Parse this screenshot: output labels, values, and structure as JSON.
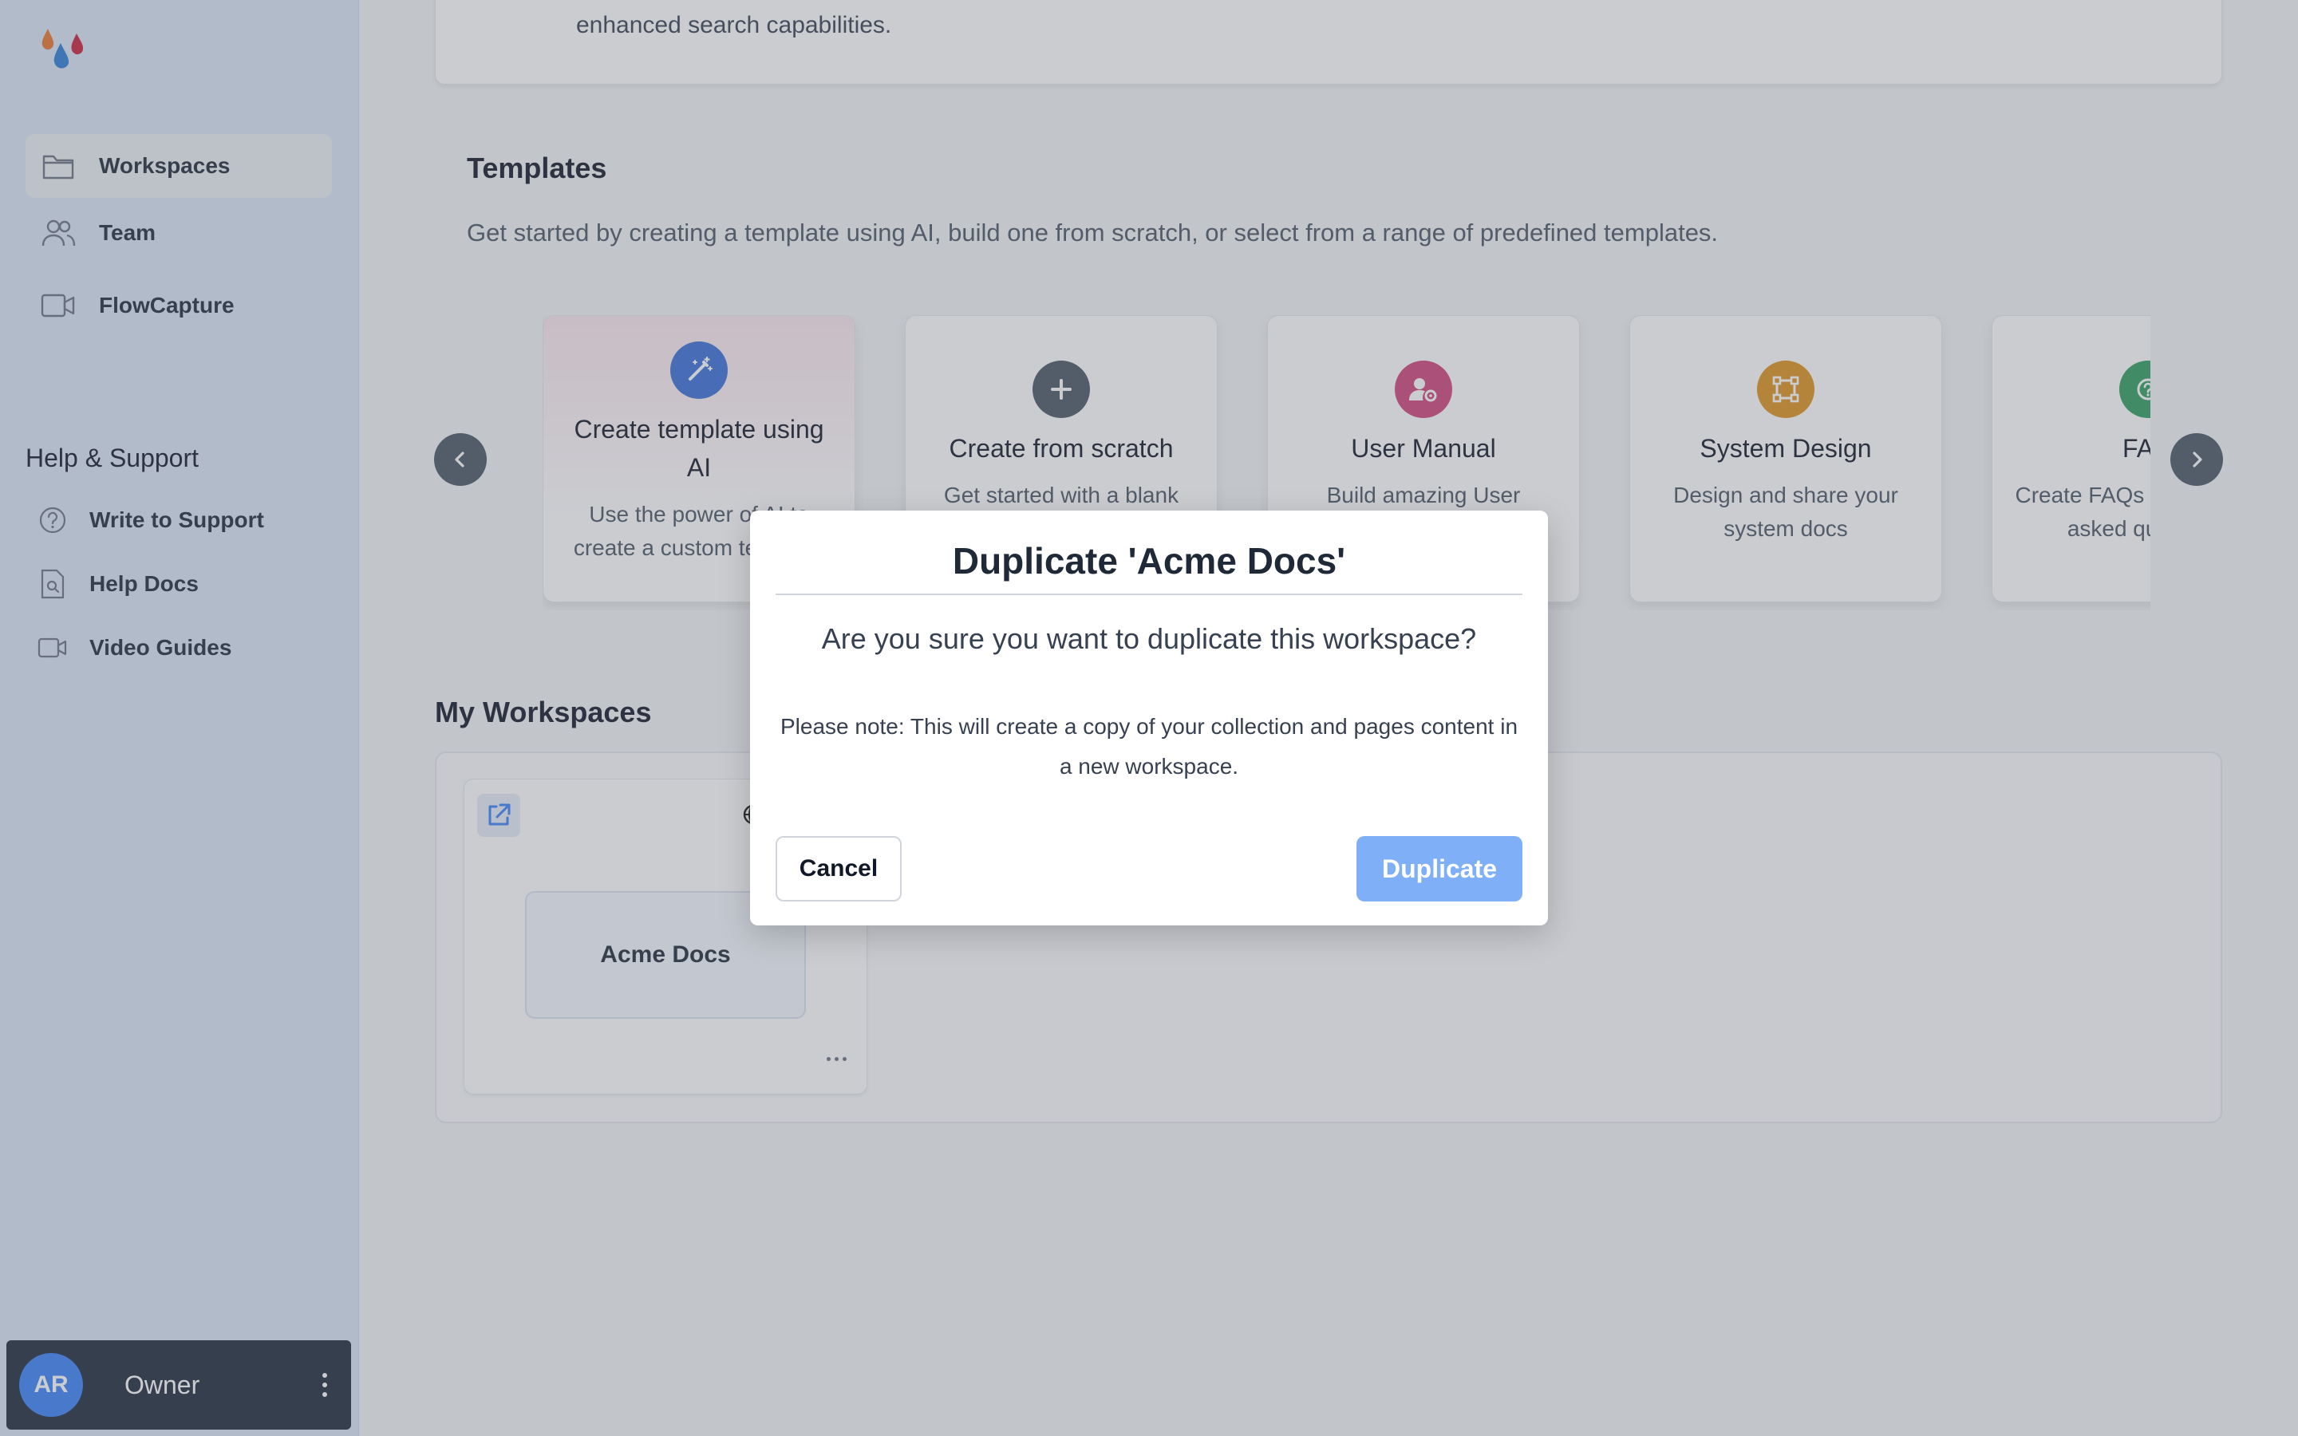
{
  "sidebar": {
    "nav": [
      {
        "label": "Workspaces",
        "icon": "folder-icon",
        "active": true
      },
      {
        "label": "Team",
        "icon": "users-icon",
        "active": false
      },
      {
        "label": "FlowCapture",
        "icon": "video-icon",
        "active": false
      }
    ],
    "help_title": "Help & Support",
    "help_items": [
      {
        "label": "Write to Support",
        "icon": "question-circle-icon"
      },
      {
        "label": "Help Docs",
        "icon": "document-search-icon"
      },
      {
        "label": "Video Guides",
        "icon": "video-icon"
      }
    ],
    "user": {
      "initials": "AR",
      "role": "Owner"
    }
  },
  "main": {
    "top_card_text": "enhanced search capabilities.",
    "templates": {
      "title": "Templates",
      "subtitle": "Get started by creating a template using AI, build one from scratch, or select from a range of predefined templates.",
      "cards": [
        {
          "title": "Create template using AI",
          "desc": "Use the power of AI to create a custom template",
          "icon": "magic-wand-icon",
          "color": "#3b6fd8"
        },
        {
          "title": "Create from scratch",
          "desc": "Get started with a blank template",
          "icon": "plus-icon",
          "color": "#4b5563"
        },
        {
          "title": "User Manual",
          "desc": "Build amazing User manuals",
          "icon": "user-settings-icon",
          "color": "#d1437a"
        },
        {
          "title": "System Design",
          "desc": "Design and share your system docs",
          "icon": "vector-square-icon",
          "color": "#e0921e"
        },
        {
          "title": "FAQ",
          "desc": "Create FAQs for frequently asked questions",
          "icon": "question-icon",
          "color": "#2f9e5e"
        }
      ]
    },
    "workspaces": {
      "title": "My Workspaces",
      "items": [
        {
          "name": "Acme Docs"
        }
      ]
    }
  },
  "modal": {
    "title": "Duplicate 'Acme Docs'",
    "question": "Are you sure you want to duplicate this workspace?",
    "note": "Please note: This will create a copy of your collection and pages content in a new workspace.",
    "cancel_label": "Cancel",
    "confirm_label": "Duplicate"
  }
}
